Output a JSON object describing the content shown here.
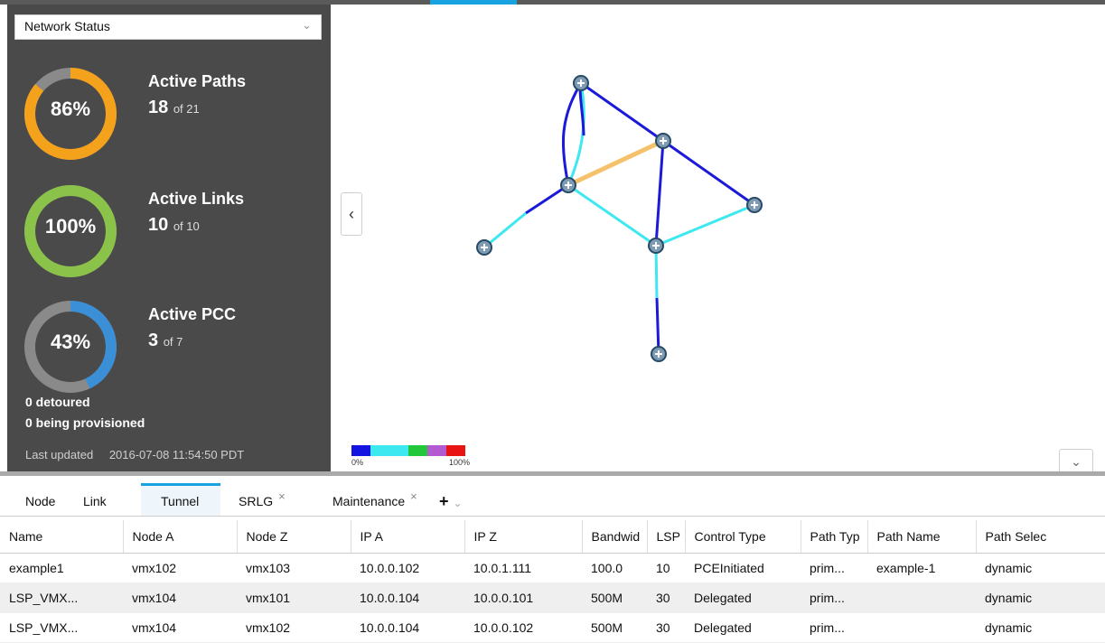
{
  "status_panel": {
    "select_value": "Network Status",
    "metrics": [
      {
        "pct": "86%",
        "title": "Active Paths",
        "count": "18",
        "of": "of 21",
        "fraction": 0.86,
        "color": "#f4a11c"
      },
      {
        "pct": "100%",
        "title": "Active Links",
        "count": "10",
        "of": "of 10",
        "fraction": 1.0,
        "color": "#8bc34a"
      },
      {
        "pct": "43%",
        "title": "Active PCC",
        "count": "3",
        "of": "of 7",
        "fraction": 0.43,
        "color": "#3b8fd6"
      }
    ],
    "detoured": "0 detoured",
    "provisioning": "0 being provisioned",
    "updated_label": "Last updated",
    "updated_value": "2016-07-08 11:54:50 PDT"
  },
  "topology": {
    "legend_min": "0%",
    "legend_max": "100%",
    "legend_colors": [
      "#1414e0",
      "#3de8f0",
      "#3de8f0",
      "#22c83a",
      "#b25bd0",
      "#e81414"
    ]
  },
  "tabs": [
    {
      "label": "Node",
      "closable": false
    },
    {
      "label": "Link",
      "closable": false
    },
    {
      "label": "Tunnel",
      "closable": false,
      "active": true
    },
    {
      "label": "SRLG",
      "closable": true
    },
    {
      "label": "Maintenance",
      "closable": true
    }
  ],
  "table": {
    "columns": [
      "Name",
      "Node A",
      "Node Z",
      "IP A",
      "IP Z",
      "Bandwid",
      "LSP",
      "Control Type",
      "Path Typ",
      "Path Name",
      "Path Selec"
    ],
    "rows": [
      [
        "example1",
        "vmx102",
        "vmx103",
        "10.0.0.102",
        "10.0.1.111",
        "100.0",
        "10",
        "PCEInitiated",
        "prim...",
        "example-1",
        "dynamic"
      ],
      [
        "LSP_VMX...",
        "vmx104",
        "vmx101",
        "10.0.0.104",
        "10.0.0.101",
        "500M",
        "30",
        "Delegated",
        "prim...",
        "",
        "dynamic"
      ],
      [
        "LSP_VMX...",
        "vmx104",
        "vmx102",
        "10.0.0.104",
        "10.0.0.102",
        "500M",
        "30",
        "Delegated",
        "prim...",
        "",
        "dynamic"
      ]
    ]
  }
}
